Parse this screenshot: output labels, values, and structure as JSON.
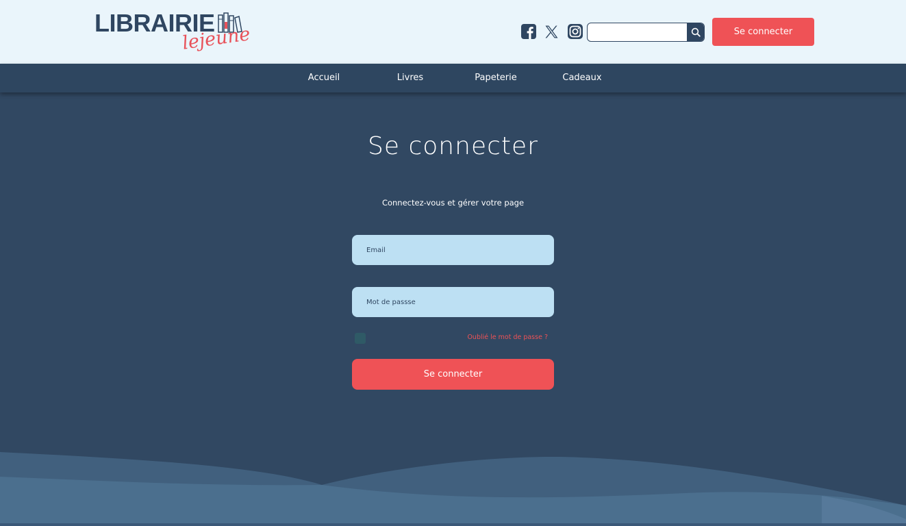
{
  "header": {
    "logo": {
      "main": "LIBRAIRIE",
      "script": "lejeune"
    },
    "socials": [
      {
        "icon": "facebook-icon"
      },
      {
        "icon": "x-twitter-icon"
      },
      {
        "icon": "instagram-icon"
      }
    ],
    "search": {
      "placeholder": "",
      "value": "",
      "icon": "search-icon"
    },
    "login_label": "Se connecter"
  },
  "nav": {
    "items": [
      {
        "label": "Accueil"
      },
      {
        "label": "Livres"
      },
      {
        "label": "Papeterie"
      },
      {
        "label": "Cadeaux"
      }
    ]
  },
  "main": {
    "title": "Se connecter",
    "subtitle": "Connectez-vous et gérer votre page",
    "email_placeholder": "Email",
    "password_placeholder": "Mot de passse",
    "remember_checked": false,
    "forgot_label": "Oublié le mot de passe ?",
    "submit_label": "Se connecter"
  },
  "colors": {
    "header_bg": "#eaf5fb",
    "page_bg": "#314862",
    "nav_bg": "#2e4660",
    "accent": "#ef5256",
    "input_bg": "#bde0f3",
    "brand_dark": "#2f4661",
    "wave_light": "#4a6d8c"
  }
}
